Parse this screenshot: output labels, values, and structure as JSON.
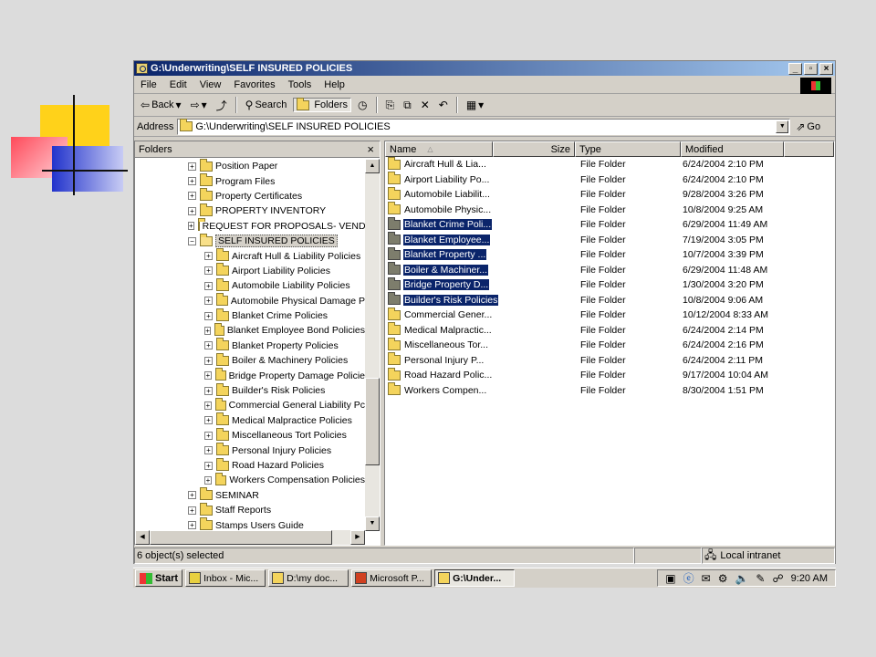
{
  "window": {
    "title": "G:\\Underwriting\\SELF INSURED POLICIES",
    "btn_min": "_",
    "btn_max": "▫",
    "btn_close": "×"
  },
  "menu": [
    "File",
    "Edit",
    "View",
    "Favorites",
    "Tools",
    "Help"
  ],
  "toolbar": {
    "back": "Back",
    "search": "Search",
    "folders": "Folders"
  },
  "address": {
    "label": "Address",
    "value": "G:\\Underwriting\\SELF INSURED POLICIES",
    "go": "Go"
  },
  "folders_pane": {
    "title": "Folders",
    "close": "×",
    "items": [
      {
        "label": "Position Paper",
        "level": 1,
        "state": "plus"
      },
      {
        "label": "Program Files",
        "level": 1,
        "state": "plus"
      },
      {
        "label": "Property Certificates",
        "level": 1,
        "state": "plus"
      },
      {
        "label": "PROPERTY INVENTORY",
        "level": 1,
        "state": "plus"
      },
      {
        "label": "REQUEST FOR PROPOSALS- VEND",
        "level": 1,
        "state": "plus"
      },
      {
        "label": "SELF INSURED POLICIES",
        "level": 1,
        "state": "minus",
        "highlight": true
      },
      {
        "label": "Aircraft Hull & Liability Policies",
        "level": 2,
        "state": "plus"
      },
      {
        "label": "Airport Liability Policies",
        "level": 2,
        "state": "plus"
      },
      {
        "label": "Automobile Liability Policies",
        "level": 2,
        "state": "plus"
      },
      {
        "label": "Automobile Physical Damage P",
        "level": 2,
        "state": "plus"
      },
      {
        "label": "Blanket Crime Policies",
        "level": 2,
        "state": "plus"
      },
      {
        "label": "Blanket Employee Bond Policies",
        "level": 2,
        "state": "plus"
      },
      {
        "label": "Blanket Property Policies",
        "level": 2,
        "state": "plus"
      },
      {
        "label": "Boiler & Machinery Policies",
        "level": 2,
        "state": "plus"
      },
      {
        "label": "Bridge Property Damage Policie",
        "level": 2,
        "state": "plus"
      },
      {
        "label": "Builder's Risk Policies",
        "level": 2,
        "state": "plus"
      },
      {
        "label": "Commercial General Liability Pc",
        "level": 2,
        "state": "plus"
      },
      {
        "label": "Medical Malpractice Policies",
        "level": 2,
        "state": "plus"
      },
      {
        "label": "Miscellaneous Tort Policies",
        "level": 2,
        "state": "plus"
      },
      {
        "label": "Personal Injury Policies",
        "level": 2,
        "state": "plus"
      },
      {
        "label": "Road Hazard Policies",
        "level": 2,
        "state": "plus"
      },
      {
        "label": "Workers Compensation Policies",
        "level": 2,
        "state": "plus"
      },
      {
        "label": "SEMINAR",
        "level": 1,
        "state": "plus"
      },
      {
        "label": "Staff Reports",
        "level": 1,
        "state": "plus"
      },
      {
        "label": "Stamps Users Guide",
        "level": 1,
        "state": "plus"
      }
    ]
  },
  "columns": {
    "name": "Name",
    "size": "Size",
    "type": "Type",
    "modified": "Modified"
  },
  "files": [
    {
      "name": "Aircraft Hull & Lia...",
      "type": "File Folder",
      "modified": "6/24/2004 2:10 PM",
      "selected": false
    },
    {
      "name": "Airport Liability Po...",
      "type": "File Folder",
      "modified": "6/24/2004 2:10 PM",
      "selected": false
    },
    {
      "name": "Automobile Liabilit...",
      "type": "File Folder",
      "modified": "9/28/2004 3:26 PM",
      "selected": false
    },
    {
      "name": "Automobile Physic...",
      "type": "File Folder",
      "modified": "10/8/2004 9:25 AM",
      "selected": false
    },
    {
      "name": "Blanket Crime Poli...",
      "type": "File Folder",
      "modified": "6/29/2004 11:49 AM",
      "selected": true
    },
    {
      "name": "Blanket Employee...",
      "type": "File Folder",
      "modified": "7/19/2004 3:05 PM",
      "selected": true
    },
    {
      "name": "Blanket Property ...",
      "type": "File Folder",
      "modified": "10/7/2004 3:39 PM",
      "selected": true
    },
    {
      "name": "Boiler & Machiner...",
      "type": "File Folder",
      "modified": "6/29/2004 11:48 AM",
      "selected": true
    },
    {
      "name": "Bridge Property D...",
      "type": "File Folder",
      "modified": "1/30/2004 3:20 PM",
      "selected": true
    },
    {
      "name": "Builder's Risk Policies",
      "type": "File Folder",
      "modified": "10/8/2004 9:06 AM",
      "selected": true
    },
    {
      "name": "Commercial Gener...",
      "type": "File Folder",
      "modified": "10/12/2004 8:33 AM",
      "selected": false
    },
    {
      "name": "Medical Malpractic...",
      "type": "File Folder",
      "modified": "6/24/2004 2:14 PM",
      "selected": false
    },
    {
      "name": "Miscellaneous Tor...",
      "type": "File Folder",
      "modified": "6/24/2004 2:16 PM",
      "selected": false
    },
    {
      "name": "Personal Injury P...",
      "type": "File Folder",
      "modified": "6/24/2004 2:11 PM",
      "selected": false
    },
    {
      "name": "Road Hazard Polic...",
      "type": "File Folder",
      "modified": "9/17/2004 10:04 AM",
      "selected": false
    },
    {
      "name": "Workers Compen...",
      "type": "File Folder",
      "modified": "8/30/2004 1:51 PM",
      "selected": false
    }
  ],
  "status": {
    "selection": "6 object(s) selected",
    "zone": "Local intranet"
  },
  "taskbar": {
    "start": "Start",
    "buttons": [
      {
        "label": "Inbox - Mic...",
        "active": false,
        "color": "#e8d040"
      },
      {
        "label": "D:\\my doc...",
        "active": false,
        "color": "#f4d45c"
      },
      {
        "label": "Microsoft P...",
        "active": false,
        "color": "#d04020"
      },
      {
        "label": "G:\\Under...",
        "active": true,
        "color": "#f4d45c"
      }
    ],
    "clock": "9:20 AM"
  }
}
